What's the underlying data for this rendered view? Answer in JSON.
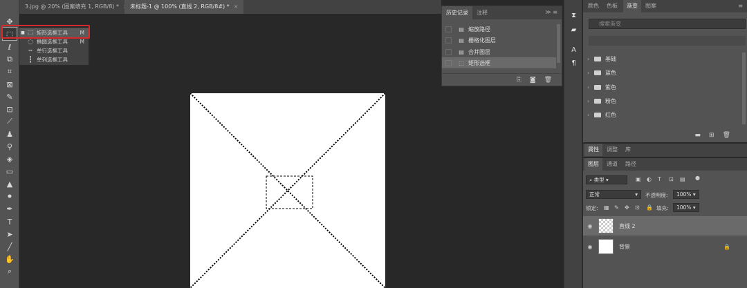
{
  "tabs": [
    {
      "label": "3.jpg @ 20% (图案填充 1, RGB/8) *",
      "close": "×"
    },
    {
      "label": "未标题-1 @ 100% (直线 2, RGB/8#) *",
      "close": "×"
    }
  ],
  "flyout": {
    "items": [
      {
        "label": "矩形选框工具",
        "key": "M"
      },
      {
        "label": "椭圆选框工具",
        "key": "M"
      },
      {
        "label": "单行选框工具",
        "key": ""
      },
      {
        "label": "单列选框工具",
        "key": ""
      }
    ]
  },
  "history": {
    "tabs": [
      "历史记录",
      "注释"
    ],
    "items": [
      "缩放路径",
      "栅格化图层",
      "合并图层",
      "矩形选框"
    ]
  },
  "swatches": {
    "tabs": [
      "颜色",
      "色板",
      "渐变",
      "图案"
    ],
    "search_placeholder": "搜索渐变",
    "groups": [
      "基础",
      "蓝色",
      "紫色",
      "粉色",
      "红色"
    ]
  },
  "props_tabs": [
    "属性",
    "调整",
    "库"
  ],
  "layers": {
    "tabs": [
      "图层",
      "通道",
      "路径"
    ],
    "kind": "类型",
    "blend_mode": "正常",
    "opacity_label": "不透明度:",
    "opacity": "100%",
    "lock_label": "锁定:",
    "fill_label": "填充:",
    "fill": "100%",
    "rows": [
      {
        "name": "直线 2"
      },
      {
        "name": "背景"
      }
    ]
  }
}
